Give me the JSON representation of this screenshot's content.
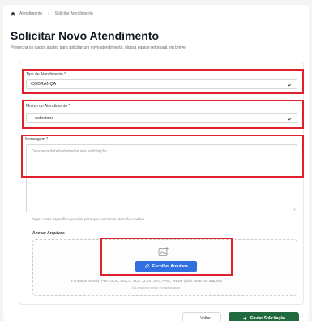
{
  "breadcrumb": {
    "home": "Atendimento",
    "current": "Solicitar Atendimento"
  },
  "header": {
    "title": "Solicitar Novo Atendimento",
    "subtitle": "Preencha os dados abaixo para solicitar um novo atendimento. Nossa equipe retornará em breve."
  },
  "form": {
    "tipo": {
      "label": "Tipo de Atendimento *",
      "value": "COBRANÇA"
    },
    "motivo": {
      "label": "Motivo do Atendimento *",
      "value": "-- selecione --"
    },
    "mensagem": {
      "label": "Mensagem *",
      "placeholder": "Descreva detalhadamente sua solicitação...",
      "hint": "Seja o mais específico possível para que possamos atendê-lo melhor."
    },
    "anexos": {
      "label": "Anexar Arquivos",
      "button": "Escolher Arquivos",
      "formats": "Formatos aceitos: PDF, DOC, DOCX, XLS, XLSX, JPG, PNG, WEBP (máx. 5MB por arquivo)",
      "note": "Os arquivos serão enviados após"
    },
    "actions": {
      "back": "Voltar",
      "submit": "Enviar Solicitação"
    }
  },
  "colors": {
    "primary": "#23693f",
    "upload": "#2f6fe0",
    "highlight": "#e0202a"
  }
}
